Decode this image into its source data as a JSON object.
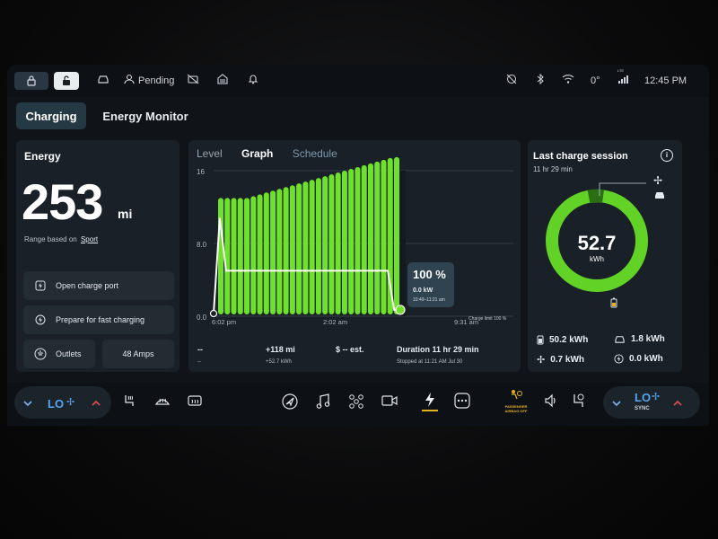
{
  "status_bar": {
    "pending_label": "Pending",
    "temperature": "0°",
    "time": "12:45 PM",
    "signal_label": "LTE"
  },
  "tabs": [
    {
      "label": "Charging",
      "active": true
    },
    {
      "label": "Energy Monitor",
      "active": false
    }
  ],
  "energy": {
    "heading": "Energy",
    "range_value": "253",
    "range_unit": "mi",
    "range_based_on_prefix": "Range based on",
    "range_mode": "Sport",
    "buttons": {
      "open_port": "Open charge port",
      "fast_charging": "Prepare for fast charging",
      "outlets": "Outlets",
      "amps": "48 Amps"
    }
  },
  "graph": {
    "subtabs": [
      "Level",
      "Graph",
      "Schedule"
    ],
    "active_subtab": "Graph",
    "tooltip": {
      "percent": "100 %",
      "power": "0.0 kW",
      "time_range": "10:49–11:21 am"
    },
    "charge_limit_label": "Charge limit 100 %",
    "summary": {
      "left_top": "--",
      "left_bottom": "--",
      "miles": "+118 mi",
      "kwh": "+52.7 kWh",
      "cost": "$ -- est.",
      "duration": "Duration 11 hr 29 min",
      "stopped": "Stopped at 11:21 AM Jul 30"
    }
  },
  "chart_data": {
    "type": "bar",
    "ylabel": "",
    "xlabel": "",
    "yticks": [
      "16",
      "8.0",
      "0.0"
    ],
    "xtick_labels": [
      "6:02 pm",
      "2:02 am",
      "9:31 am"
    ],
    "ylim": [
      0,
      16
    ],
    "series": [
      {
        "values": [
          13,
          13,
          13,
          13,
          13,
          13.2,
          13.4,
          13.6,
          13.8,
          14.0,
          14.2,
          14.4,
          14.6,
          14.8,
          15.0,
          15.2,
          15.4,
          15.6,
          15.8,
          16.0,
          16.2,
          16.4,
          16.6,
          16.8,
          17.0,
          17.2,
          17.4,
          17.6
        ]
      },
      {
        "values": [
          0.3,
          10.8,
          5.0,
          5.0,
          5.0,
          5.0,
          5.0,
          5.0,
          5.0,
          5.0,
          5.0,
          5.0,
          5.0,
          5.0,
          5.0,
          5.0,
          5.0,
          5.0,
          5.0,
          5.0,
          5.0,
          5.0,
          5.0,
          5.0,
          5.0,
          5.0,
          5.0,
          5.0,
          5.0,
          0.7,
          0.7
        ]
      }
    ],
    "colors": {
      "bars": "#6fe02b",
      "line": "#ffffff",
      "marker": "#6fe02b"
    }
  },
  "last_session": {
    "title": "Last charge session",
    "duration": "11 hr 29 min",
    "total_value": "52.7",
    "total_unit": "kWh",
    "breakdown": [
      {
        "icon": "battery-icon",
        "value": "50.2 kWh"
      },
      {
        "icon": "car-icon",
        "value": "1.8 kWh"
      },
      {
        "icon": "fan-icon",
        "value": "0.7 kWh"
      },
      {
        "icon": "electronics-icon",
        "value": "0.0 kWh"
      }
    ]
  },
  "bottom_bar": {
    "left_temp": "LO",
    "right_temp": "LO",
    "sync_label": "SYNC",
    "airbag_line1": "PASSENGER",
    "airbag_line2": "AIRBAG OFF",
    "accent_color": "#e5b020"
  }
}
